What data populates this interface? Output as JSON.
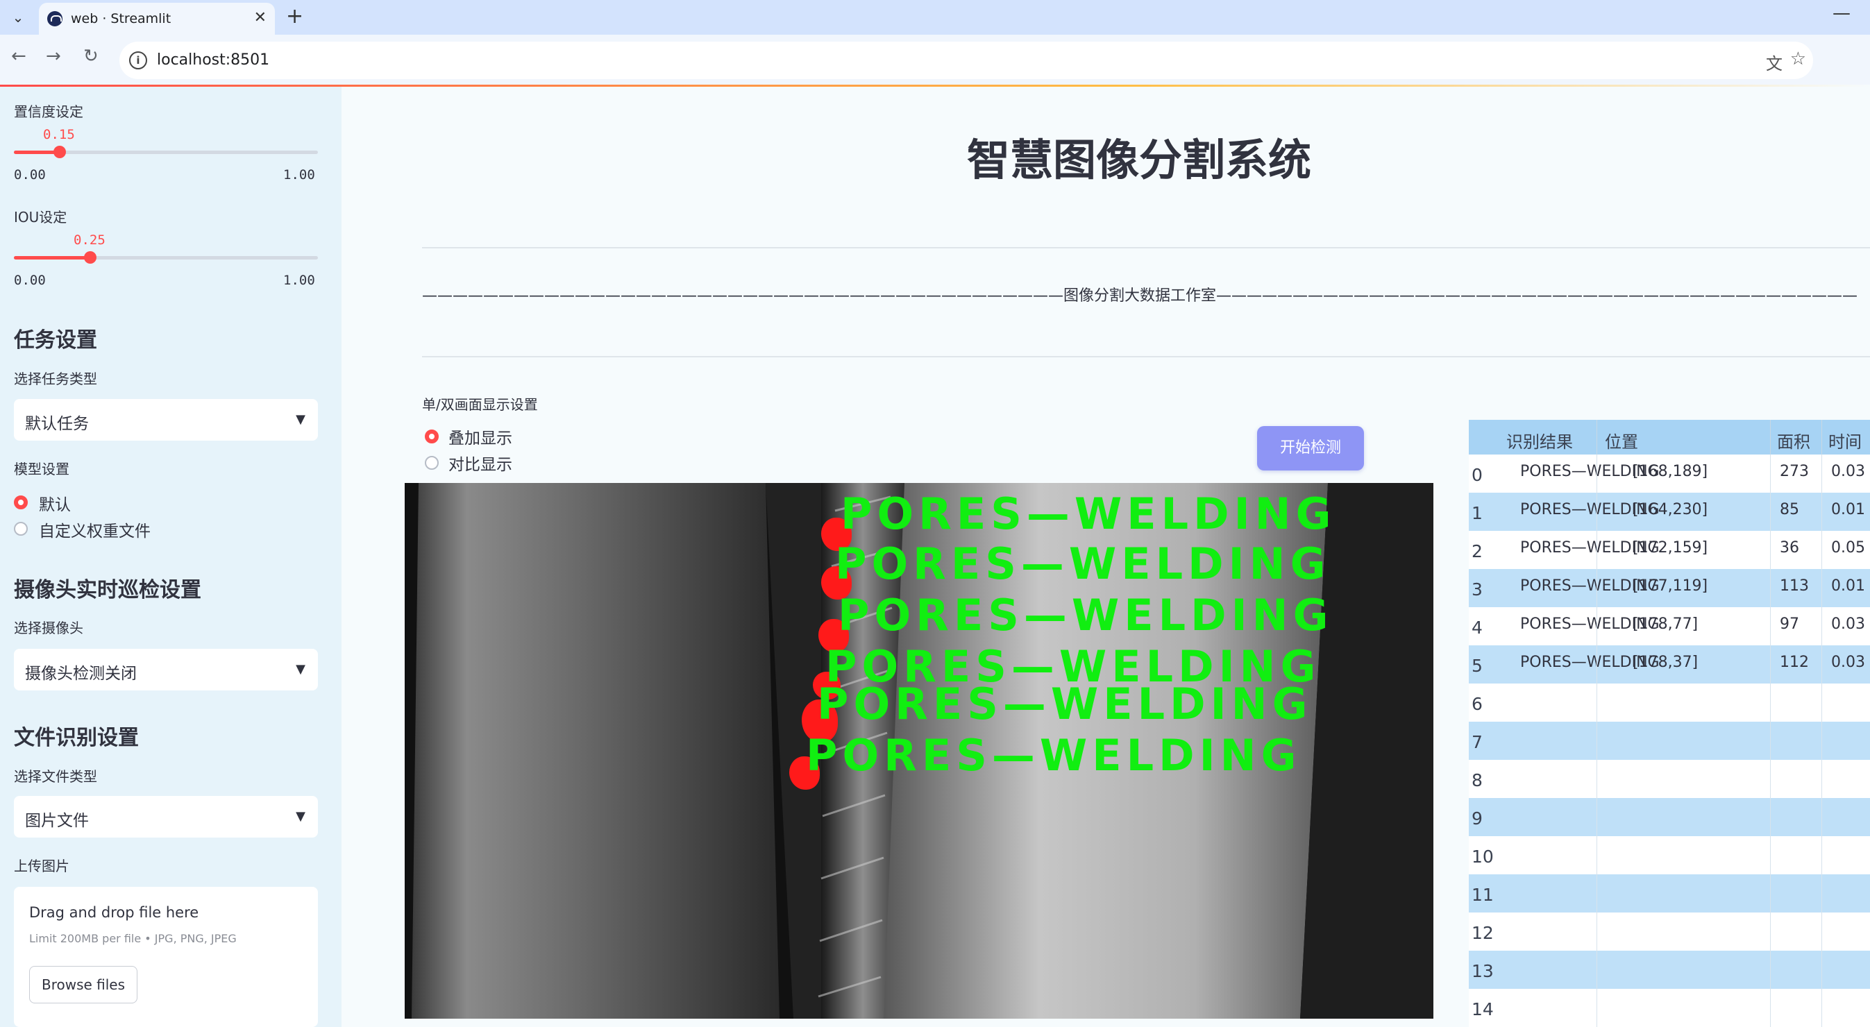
{
  "browser": {
    "tab_title": "web · Streamlit",
    "url": "localhost:8501"
  },
  "sidebar": {
    "confidence": {
      "label": "置信度设定",
      "value": "0.15",
      "fraction": 0.15,
      "min": "0.00",
      "max": "1.00"
    },
    "iou": {
      "label": "IOU设定",
      "value": "0.25",
      "fraction": 0.25,
      "min": "0.00",
      "max": "1.00"
    },
    "task_header": "任务设置",
    "task_type_label": "选择任务类型",
    "task_type_value": "默认任务",
    "model_label": "模型设置",
    "model_options": [
      "默认",
      "自定义权重文件"
    ],
    "camera_header": "摄像头实时巡检设置",
    "camera_label": "选择摄像头",
    "camera_value": "摄像头检测关闭",
    "file_header": "文件识别设置",
    "file_type_label": "选择文件类型",
    "file_type_value": "图片文件",
    "upload_label": "上传图片",
    "upload_title": "Drag and drop file here",
    "upload_limit": "Limit 200MB per file • JPG, PNG, JPEG",
    "browse_label": "Browse files"
  },
  "main": {
    "title": "智慧图像分割系统",
    "studio_line": "——————————————————————————————————————————图像分割大数据工作室——————————————————————————————————————————",
    "display_label": "单/双画面显示设置",
    "display_options": [
      "叠加显示",
      "对比显示"
    ],
    "start_button": "开始检测",
    "detection_label": "PORES—WELDING"
  },
  "table": {
    "headers": [
      "识别结果",
      "位置",
      "面积",
      "时间"
    ],
    "rows": [
      {
        "index": "0",
        "result": "PORES—WELDING",
        "position": "[168,189]",
        "area": "273",
        "time": "0.03"
      },
      {
        "index": "1",
        "result": "PORES—WELDING",
        "position": "[164,230]",
        "area": "85",
        "time": "0.01"
      },
      {
        "index": "2",
        "result": "PORES—WELDING",
        "position": "[172,159]",
        "area": "36",
        "time": "0.05"
      },
      {
        "index": "3",
        "result": "PORES—WELDING",
        "position": "[177,119]",
        "area": "113",
        "time": "0.01"
      },
      {
        "index": "4",
        "result": "PORES—WELDING",
        "position": "[178,77]",
        "area": "97",
        "time": "0.03"
      },
      {
        "index": "5",
        "result": "PORES—WELDING",
        "position": "[178,37]",
        "area": "112",
        "time": "0.03"
      },
      {
        "index": "6",
        "result": "",
        "position": "",
        "area": "",
        "time": ""
      },
      {
        "index": "7",
        "result": "",
        "position": "",
        "area": "",
        "time": ""
      },
      {
        "index": "8",
        "result": "",
        "position": "",
        "area": "",
        "time": ""
      },
      {
        "index": "9",
        "result": "",
        "position": "",
        "area": "",
        "time": ""
      },
      {
        "index": "10",
        "result": "",
        "position": "",
        "area": "",
        "time": ""
      },
      {
        "index": "11",
        "result": "",
        "position": "",
        "area": "",
        "time": ""
      },
      {
        "index": "12",
        "result": "",
        "position": "",
        "area": "",
        "time": ""
      },
      {
        "index": "13",
        "result": "",
        "position": "",
        "area": "",
        "time": ""
      },
      {
        "index": "14",
        "result": "",
        "position": "",
        "area": "",
        "time": ""
      }
    ]
  },
  "colors": {
    "accent": "#ff4b4b",
    "sidebar_bg": "#e6f3fa",
    "button": "#8e95f5",
    "table_header": "#a7d3f4",
    "detection_text": "#11ee11",
    "mask": "#ff1a1a"
  }
}
